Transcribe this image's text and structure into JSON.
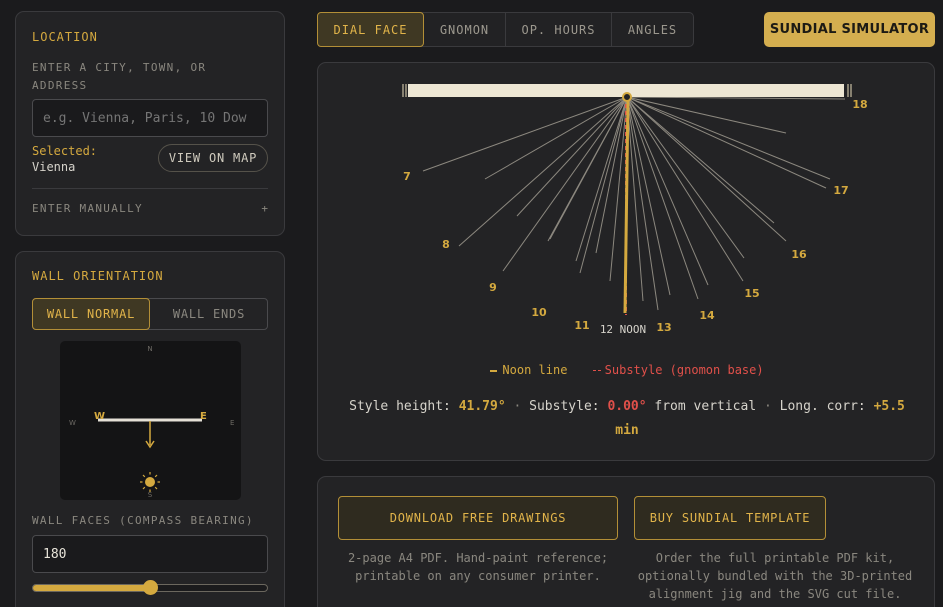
{
  "location": {
    "title": "LOCATION",
    "prompt": "ENTER A CITY, TOWN, OR ADDRESS",
    "placeholder": "e.g. Vienna, Paris, 10 Dow",
    "selected_label": "Selected:",
    "selected_value": "Vienna",
    "map_button": "VIEW ON MAP",
    "manual_label": "ENTER MANUALLY",
    "manual_icon": "+"
  },
  "wall": {
    "title": "WALL ORIENTATION",
    "toggle": [
      "WALL NORMAL",
      "WALL ENDS"
    ],
    "compass": {
      "n": "N",
      "s": "S",
      "e": "E",
      "w": "W",
      "wall_w": "W",
      "wall_e": "E"
    },
    "faces_label": "WALL FACES (COMPASS BEARING)",
    "bearing_value": "180",
    "slider_fraction": 0.5
  },
  "tabs": [
    "DIAL FACE",
    "GNOMON",
    "OP. HOURS",
    "ANGLES"
  ],
  "brand_button": "SUNDIAL SIMULATOR",
  "dial": {
    "hour_labels": [
      "7",
      "8",
      "9",
      "10",
      "11",
      "12 NOON",
      "13",
      "14",
      "15",
      "16",
      "17",
      "18"
    ],
    "legend_noon": "Noon line",
    "legend_substyle": "Substyle (gnomon base)",
    "info": {
      "style_label": "Style height:",
      "style_value": "41.79°",
      "sep1": "·",
      "substyle_label": "Substyle:",
      "substyle_value": "0.00°",
      "substyle_suffix": "from vertical",
      "sep2": "·",
      "long_label": "Long. corr:",
      "long_value": "+5.5 min"
    }
  },
  "actions": {
    "download_label": "DOWNLOAD FREE DRAWINGS",
    "download_desc": "2-page A4 PDF. Hand-paint reference; printable on any consumer printer.",
    "buy_label": "BUY SUNDIAL TEMPLATE",
    "buy_desc": "Order the full printable PDF kit, optionally bundled with the 3D-printed alignment jig and the SVG cut file."
  },
  "colors": {
    "accent": "#d4a93f",
    "substyle": "#e0504a",
    "background": "#1b1b1d",
    "panel": "#232325"
  }
}
